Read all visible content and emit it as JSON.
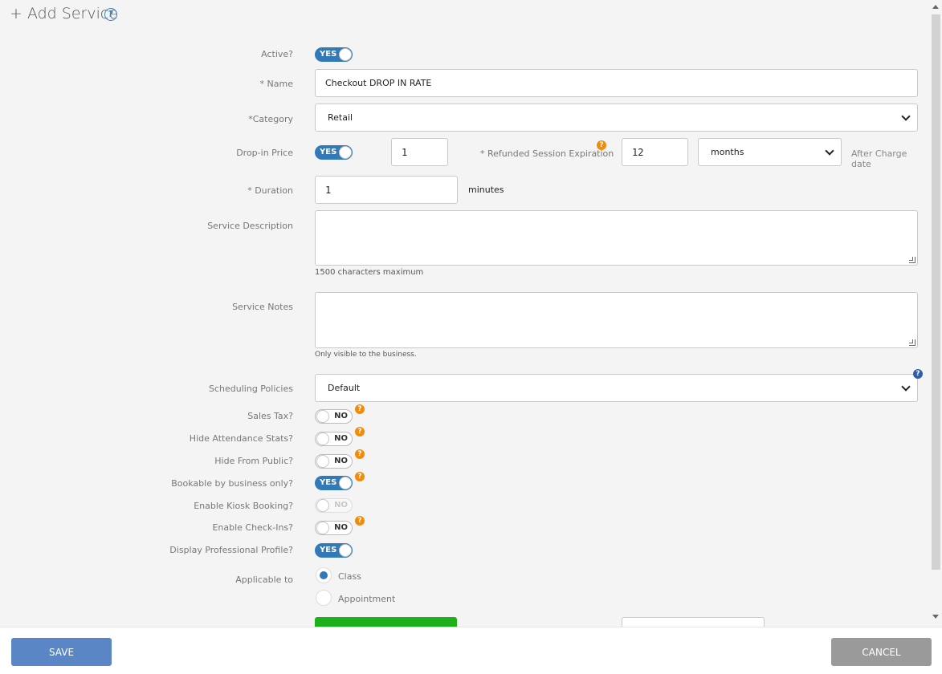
{
  "page": {
    "title": "+ Add Service",
    "title_help": "?"
  },
  "form": {
    "active": {
      "label": "Active?",
      "state": "YES"
    },
    "name": {
      "label": "* Name",
      "value": "Checkout DROP IN RATE"
    },
    "category": {
      "label": "*Category",
      "value": "Retail"
    },
    "dropin": {
      "label": "Drop-in Price",
      "state": "YES",
      "price": "1",
      "refund_label": "* Refunded Session Expiration",
      "refund_value": "12",
      "refund_unit": "months",
      "after_charge": "After Charge date"
    },
    "duration": {
      "label": "* Duration",
      "value": "1",
      "unit": "minutes"
    },
    "description": {
      "label": "Service Description",
      "hint": "1500 characters maximum"
    },
    "notes": {
      "label": "Service Notes",
      "hint": "Only visible to the business."
    },
    "scheduling": {
      "label": "Scheduling Policies",
      "value": "Default"
    },
    "toggles": [
      {
        "label": "Sales Tax?",
        "state": "NO"
      },
      {
        "label": "Hide Attendance Stats?",
        "state": "NO"
      },
      {
        "label": "Hide From Public?",
        "state": "NO"
      },
      {
        "label": "Bookable by business only?",
        "state": "YES"
      },
      {
        "label": "Enable Kiosk Booking?",
        "state": "NO"
      },
      {
        "label": "Enable Check-Ins?",
        "state": "NO"
      },
      {
        "label": "Display Professional Profile?",
        "state": "YES"
      }
    ],
    "applicable": {
      "label": "Applicable to",
      "options": [
        "Class",
        "Appointment"
      ],
      "selected": "Class"
    }
  },
  "footer": {
    "save": "SAVE",
    "cancel": "CANCEL"
  },
  "colors": {
    "accent": "#3379b7",
    "warning_badge": "#f08c0a",
    "success": "#1db01b"
  }
}
